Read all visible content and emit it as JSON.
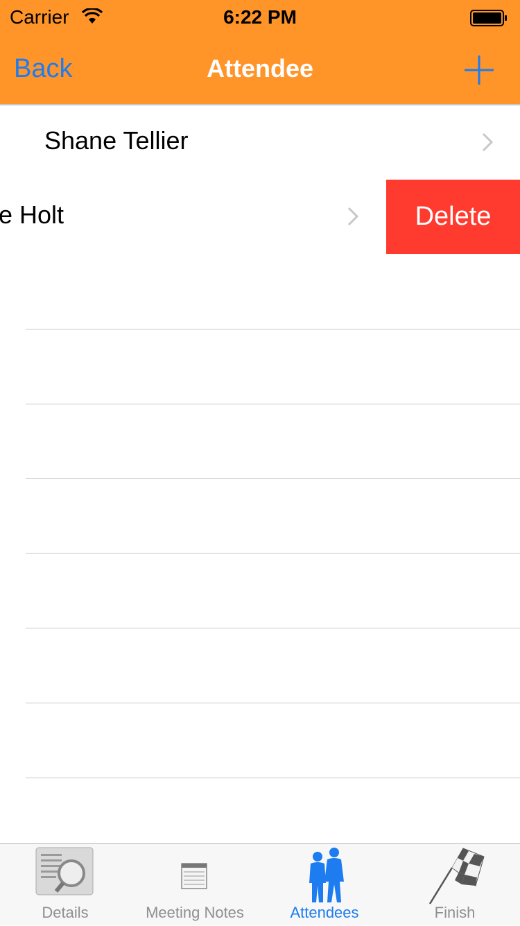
{
  "status_bar": {
    "carrier": "Carrier",
    "time": "6:22 PM"
  },
  "nav": {
    "back_label": "Back",
    "title": "Attendee",
    "add_icon": "plus-icon"
  },
  "attendees": [
    {
      "name": "Shane Tellier"
    },
    {
      "name": "e Holt",
      "swiped": true
    }
  ],
  "delete_label": "Delete",
  "tabs": [
    {
      "label": "Details",
      "icon": "magnifier-document-icon",
      "active": false
    },
    {
      "label": "Meeting Notes",
      "icon": "notepad-icon",
      "active": false
    },
    {
      "label": "Attendees",
      "icon": "people-icon",
      "active": true
    },
    {
      "label": "Finish",
      "icon": "checkered-flag-icon",
      "active": false
    }
  ],
  "colors": {
    "header": "#FF9429",
    "accent": "#1C7CF0",
    "delete": "#FF3B30"
  }
}
